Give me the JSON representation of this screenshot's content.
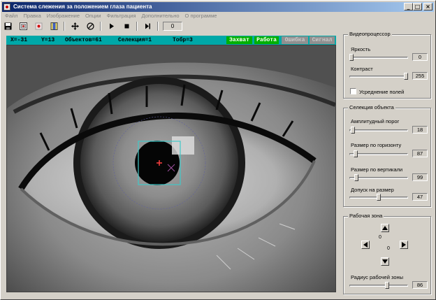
{
  "window": {
    "title": "Система слежения за положением глаза пациента"
  },
  "window_buttons": {
    "minimize": "_",
    "maximize": "□",
    "close": "×"
  },
  "menu": [
    "Файл",
    "Правка",
    "Изображение",
    "Опции",
    "Фильтрация",
    "Дополнительно",
    "О программе"
  ],
  "toolbar": {
    "frame_counter": "0"
  },
  "icons": [
    "save-icon",
    "capture-icon",
    "record-icon",
    "palette-icon",
    "move-icon",
    "filter-icon",
    "play-icon",
    "stop-icon",
    "step-icon"
  ],
  "status": {
    "x": "X=-31",
    "y": "Y=13",
    "objects": "Объектов=61",
    "selection": "Селекция=1",
    "tobr": "Тобр=3"
  },
  "indicators": {
    "capture": "Захват",
    "work": "Работа",
    "error": "Ошибка",
    "signal": "Сигнал"
  },
  "colors": {
    "title_start": "#0a246a",
    "title_end": "#a6caf0",
    "status_bar": "#00a8a8",
    "indicator_on": "#00b000",
    "indicator_off": "#909090",
    "roi_box": "#40c8c8",
    "cursor": "#ff4040"
  },
  "video_processor": {
    "title": "Видеопроцессор",
    "brightness": {
      "label": "Яркость",
      "value": "0",
      "level": 0
    },
    "contrast": {
      "label": "Контраст",
      "value": "255",
      "level": 1
    },
    "averaging_label": "Усреднение полей",
    "averaging_checked": false
  },
  "selection": {
    "title": "Селекция объекта",
    "threshold": {
      "label": "Амплитудный порог",
      "value": "18",
      "level": 0.02
    },
    "h_size": {
      "label": "Размер по горизонту",
      "value": "87",
      "level": 0.08
    },
    "v_size": {
      "label": "Размер по вертикали",
      "value": "99",
      "level": 0.09
    },
    "tolerance": {
      "label": "Допуск на размер",
      "value": "47",
      "level": 0.5
    }
  },
  "work_zone": {
    "title": "Рабочая зона",
    "y_value": "0",
    "x_value": "0",
    "radius": {
      "label": "Радиус рабочей зоны",
      "value": "86",
      "level": 0.65
    }
  }
}
